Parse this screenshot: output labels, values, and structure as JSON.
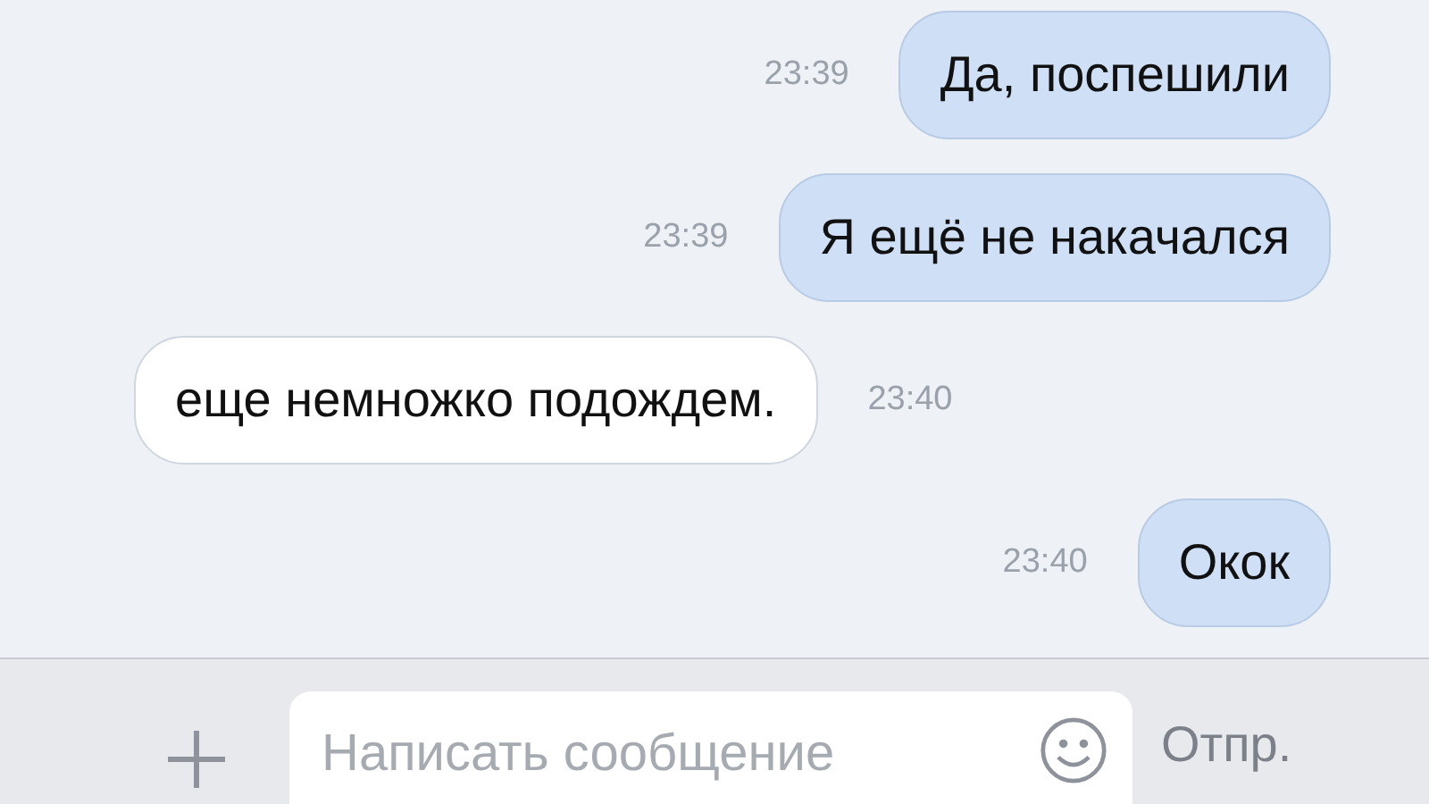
{
  "messages": [
    {
      "kind": "outgoing",
      "text": "Да, поспешили",
      "time": "23:39"
    },
    {
      "kind": "outgoing",
      "text": "Я ещё не накачался",
      "time": "23:39"
    },
    {
      "kind": "incoming",
      "text": "еще немножко подождем.",
      "time": "23:40"
    },
    {
      "kind": "outgoing",
      "text": "Окок",
      "time": "23:40"
    }
  ],
  "composer": {
    "placeholder": "Написать сообщение",
    "send": "Отпр."
  }
}
